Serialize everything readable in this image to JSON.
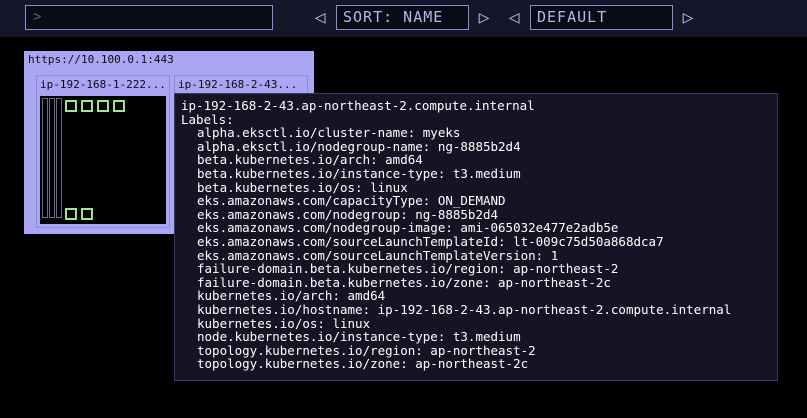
{
  "toolbar": {
    "search_value": ">",
    "sort": {
      "prev_icon": "◁",
      "label": "SORT: NAME",
      "next_icon": "▷"
    },
    "preset": {
      "prev_icon": "◁",
      "label": "DEFAULT",
      "next_icon": "▷"
    }
  },
  "cluster": {
    "title": "https://10.100.0.1:443",
    "nodes": [
      {
        "title": "ip-192-168-1-222..."
      },
      {
        "title": "ip-192-168-2-43..."
      }
    ]
  },
  "tooltip": {
    "hostname": "ip-192-168-2-43.ap-northeast-2.compute.internal",
    "labels_header": "Labels:",
    "labels": [
      "alpha.eksctl.io/cluster-name: myeks",
      "alpha.eksctl.io/nodegroup-name: ng-8885b2d4",
      "beta.kubernetes.io/arch: amd64",
      "beta.kubernetes.io/instance-type: t3.medium",
      "beta.kubernetes.io/os: linux",
      "eks.amazonaws.com/capacityType: ON_DEMAND",
      "eks.amazonaws.com/nodegroup: ng-8885b2d4",
      "eks.amazonaws.com/nodegroup-image: ami-065032e477e2adb5e",
      "eks.amazonaws.com/sourceLaunchTemplateId: lt-009c75d50a868dca7",
      "eks.amazonaws.com/sourceLaunchTemplateVersion: 1",
      "failure-domain.beta.kubernetes.io/region: ap-northeast-2",
      "failure-domain.beta.kubernetes.io/zone: ap-northeast-2c",
      "kubernetes.io/arch: amd64",
      "kubernetes.io/hostname: ip-192-168-2-43.ap-northeast-2.compute.internal",
      "kubernetes.io/os: linux",
      "node.kubernetes.io/instance-type: t3.medium",
      "topology.kubernetes.io/region: ap-northeast-2",
      "topology.kubernetes.io/zone: ap-northeast-2c"
    ]
  },
  "colors": {
    "background": "#000000",
    "topbar": "#16162a",
    "accent": "#b8b4f2",
    "panel": "#aaa6f4",
    "pod": "#a6e08c"
  }
}
